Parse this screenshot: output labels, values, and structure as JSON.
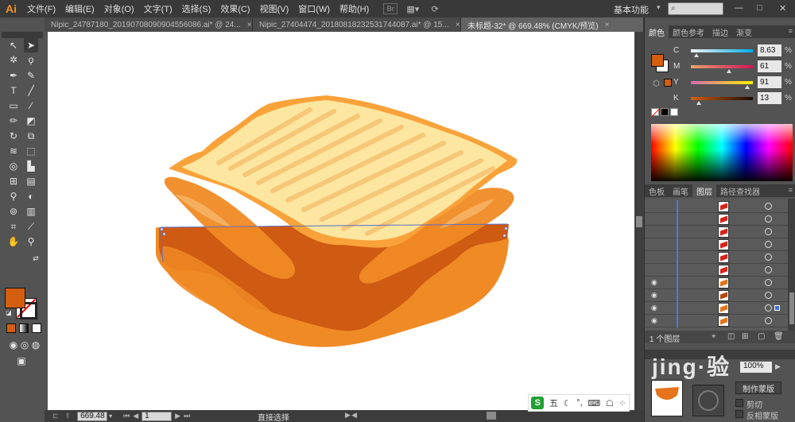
{
  "app": {
    "logo": "Ai",
    "menu": [
      "文件(F)",
      "编辑(E)",
      "对象(O)",
      "文字(T)",
      "选择(S)",
      "效果(C)",
      "视图(V)",
      "窗口(W)",
      "帮助(H)"
    ],
    "bridge_label": "Br",
    "workspace": "基本功能",
    "search_placeholder": ""
  },
  "tabs": [
    {
      "label": "Nipic_24787180_20190708090904556086.ai* @ 24...",
      "active": false
    },
    {
      "label": "Nipic_27404474_20180818232531744087.ai* @ 15...",
      "active": false
    },
    {
      "label": "未标题-32* @ 669.48% (CMYK/预览)",
      "active": true
    }
  ],
  "status": {
    "zoom": "669.48",
    "page": "1",
    "tool": "直接选择"
  },
  "color_panel": {
    "tabs": [
      "颜色",
      "颜色参考",
      "描边",
      "渐变"
    ],
    "active_tab": "颜色",
    "fill_color": "#d35e10",
    "sliders": [
      {
        "label": "C",
        "value": "8.63",
        "fraction": 0.086,
        "from": "#f2f2f2",
        "to": "#00aeef"
      },
      {
        "label": "M",
        "value": "61",
        "fraction": 0.61,
        "from": "#e8a26c",
        "to": "#d4145a"
      },
      {
        "label": "Y",
        "value": "91",
        "fraction": 0.91,
        "from": "#d36bb0",
        "to": "#fff200"
      },
      {
        "label": "K",
        "value": "13",
        "fraction": 0.13,
        "from": "#d35e10",
        "to": "#1a0a00"
      }
    ],
    "percent_sign": "%"
  },
  "layers_panel": {
    "tabs": [
      "色板",
      "画笔",
      "图层",
      "路径查找器"
    ],
    "active_tab": "图层",
    "count_label": "1 个图层",
    "rows": [
      {
        "eye": false,
        "thumb": "red"
      },
      {
        "eye": false,
        "thumb": "red"
      },
      {
        "eye": false,
        "thumb": "red"
      },
      {
        "eye": false,
        "thumb": "red"
      },
      {
        "eye": false,
        "thumb": "red"
      },
      {
        "eye": false,
        "thumb": "red"
      },
      {
        "eye": true,
        "thumb": "orange"
      },
      {
        "eye": true,
        "thumb": "dark"
      },
      {
        "eye": true,
        "thumb": "orange",
        "selected": true
      },
      {
        "eye": true,
        "thumb": "orange"
      }
    ]
  },
  "transparency_panel": {
    "opacity": "100%",
    "mask_button": "制作蒙版",
    "clip_label": "剪切",
    "invert_label": "反相蒙版"
  },
  "ime": {
    "logo": "S",
    "mode": "五"
  },
  "watermark": "jing·验"
}
